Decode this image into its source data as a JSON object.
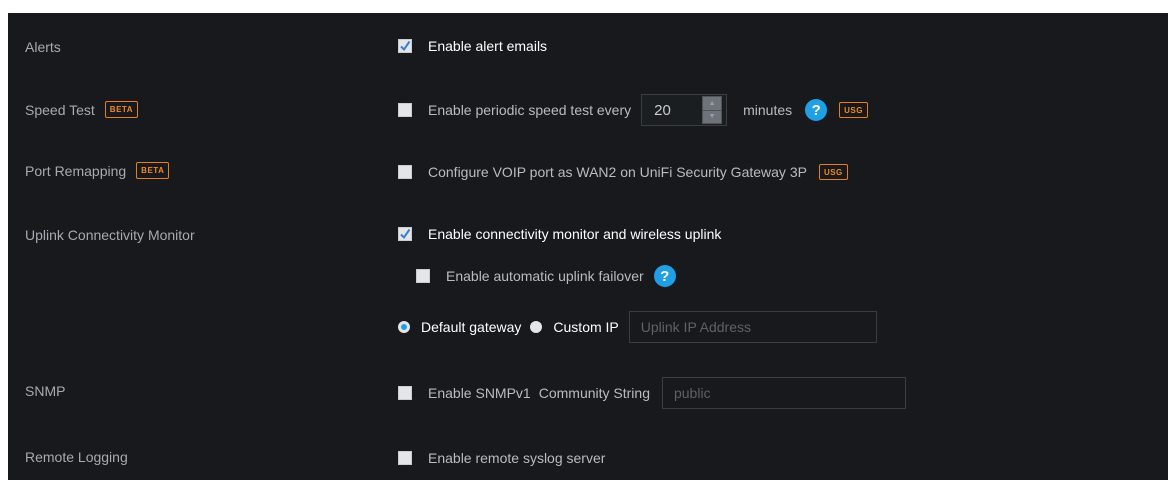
{
  "settings": {
    "alerts": {
      "label": "Alerts",
      "enable_label": "Enable alert emails",
      "checked": true
    },
    "speed_test": {
      "label": "Speed Test",
      "badge": "BETA",
      "enable_label": "Enable periodic speed test every",
      "interval_value": "20",
      "unit_label": "minutes",
      "help": "?",
      "device_badge": "USG",
      "checked": false
    },
    "port_remapping": {
      "label": "Port Remapping",
      "badge": "BETA",
      "enable_label": "Configure VOIP port as WAN2 on UniFi Security Gateway 3P",
      "device_badge": "USG",
      "checked": false
    },
    "uplink_monitor": {
      "label": "Uplink Connectivity Monitor",
      "enable_label": "Enable connectivity monitor and wireless uplink",
      "checked": true,
      "failover_label": "Enable automatic uplink failover",
      "failover_checked": false,
      "help": "?",
      "default_gateway_label": "Default gateway",
      "custom_ip_label": "Custom IP",
      "selected": "Default gateway",
      "ip_placeholder": "Uplink IP Address"
    },
    "snmp": {
      "label": "SNMP",
      "enable_label": "Enable SNMPv1",
      "community_label": "Community String",
      "community_placeholder": "public",
      "checked": false
    },
    "remote_logging": {
      "label": "Remote Logging",
      "enable_label": "Enable remote syslog server",
      "checked": false
    }
  },
  "icons": {
    "checkmark": "checkmark-icon",
    "spinner_up": "chevron-up-icon",
    "spinner_down": "chevron-down-icon",
    "help": "help-icon"
  },
  "colors": {
    "background": "#17191c",
    "accent_blue": "#1f9fe6",
    "badge_orange": "#f08a24",
    "label_gray": "#a6abb1"
  }
}
